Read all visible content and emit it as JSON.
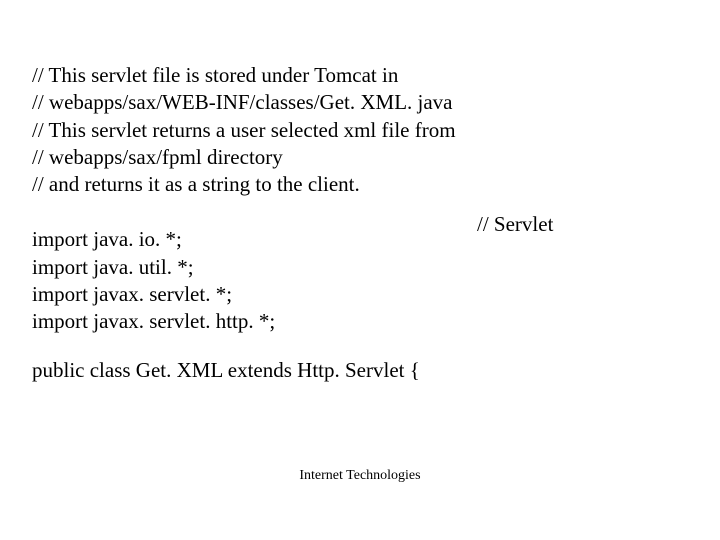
{
  "comments": {
    "line1": "// This servlet file is stored under Tomcat in",
    "line2": "//  webapps/sax/WEB-INF/classes/Get. XML. java",
    "line3": "// This servlet returns a user selected xml file from",
    "line4": "// webapps/sax/fpml directory",
    "line5": "// and returns it as a string to the client."
  },
  "servlet_comment": "// Servlet",
  "imports": {
    "line1": "import java. io. *;",
    "line2": "import java. util. *;",
    "line3": "import javax. servlet. *;",
    "line4": "import javax. servlet. http. *;"
  },
  "class_declaration": "public class Get. XML extends Http. Servlet {",
  "footer": "Internet Technologies"
}
